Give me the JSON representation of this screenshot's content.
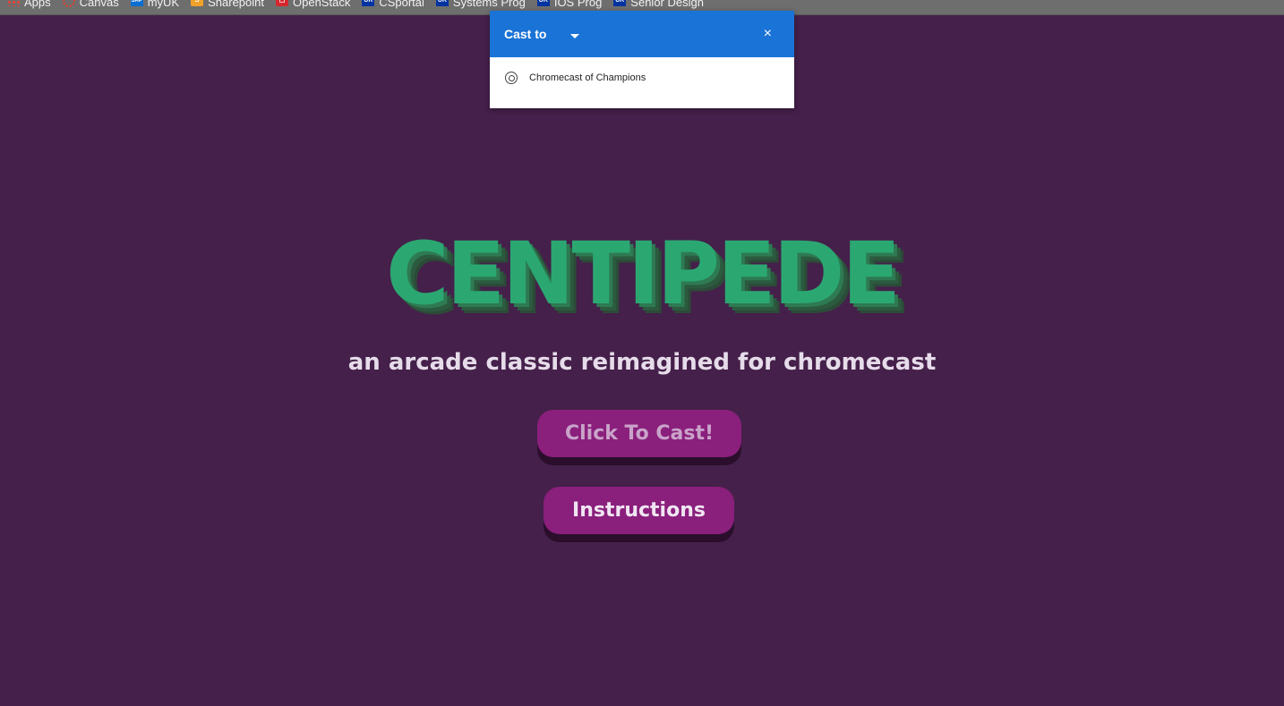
{
  "bookmarks": [
    {
      "label": "Apps",
      "icon": "apps-grid-icon"
    },
    {
      "label": "Canvas",
      "icon": "canvas-icon"
    },
    {
      "label": "myUK",
      "icon": "sap-icon"
    },
    {
      "label": "Sharepoint",
      "icon": "sharepoint-icon"
    },
    {
      "label": "OpenStack",
      "icon": "openstack-icon"
    },
    {
      "label": "CSportal",
      "icon": "uk-icon"
    },
    {
      "label": "Systems Prog",
      "icon": "uk-icon"
    },
    {
      "label": "IOS Prog",
      "icon": "uk-icon"
    },
    {
      "label": "Senior Design",
      "icon": "uk-icon"
    }
  ],
  "cast_dialog": {
    "title": "Cast to",
    "close": "×",
    "devices": [
      {
        "name": "Chromecast of Champions",
        "icon": "chrome-icon"
      }
    ],
    "header_color": "#1a73d6"
  },
  "page": {
    "title": "CENTIPEDE",
    "subtitle": "an arcade classic reimagined for chromecast",
    "cast_button": "Click To Cast!",
    "instructions_button": "Instructions",
    "background": "#45204a",
    "title_color": "#2ba872",
    "button_color": "#8a1f7c"
  }
}
